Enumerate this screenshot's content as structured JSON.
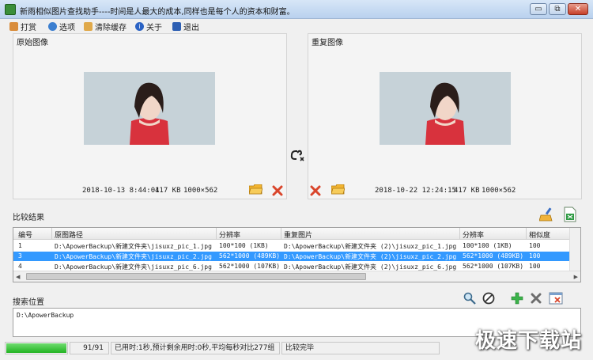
{
  "window": {
    "title": "新雨相似图片查找助手----时间是人最大的成本,同样也是每个人的资本和财富。",
    "minimize_glyph": "▭",
    "restore_glyph": "⧉",
    "close_glyph": "✕"
  },
  "menu": {
    "items": [
      {
        "label": "打赏",
        "icon": "gift-icon"
      },
      {
        "label": "选项",
        "icon": "options-icon"
      },
      {
        "label": "清除缓存",
        "icon": "broom-icon"
      },
      {
        "label": "关于",
        "icon": "info-icon"
      },
      {
        "label": "退出",
        "icon": "exit-icon"
      }
    ]
  },
  "panels": {
    "original": {
      "label": "原始图像",
      "date": "2018-10-13 8:44:01",
      "size": "417 KB",
      "dims": "1000×562"
    },
    "duplicate": {
      "label": "重复图像",
      "date": "2018-10-22 12:24:15",
      "size": "417 KB",
      "dims": "1000×562"
    }
  },
  "results": {
    "label": "比较结果",
    "headers": [
      "编号",
      "原图路径",
      "分辨率",
      "重复图片",
      "分辨率",
      "相似度"
    ],
    "rows": [
      {
        "no": "1",
        "orig": "D:\\ApowerBackup\\新建文件夹\\jisuxz_pic_1.jpg",
        "res1": "100*100 (1KB)",
        "dup": "D:\\ApowerBackup\\新建文件夹 (2)\\jisuxz_pic_1.jpg",
        "res2": "100*100 (1KB)",
        "sim": "100"
      },
      {
        "no": "3",
        "orig": "D:\\ApowerBackup\\新建文件夹\\jisuxz_pic_2.jpg",
        "res1": "562*1000 (489KB)",
        "dup": "D:\\ApowerBackup\\新建文件夹 (2)\\jisuxz_pic_2.jpg",
        "res2": "562*1000 (489KB)",
        "sim": "100"
      },
      {
        "no": "4",
        "orig": "D:\\ApowerBackup\\新建文件夹\\jisuxz_pic_6.jpg",
        "res1": "562*1000 (107KB)",
        "dup": "D:\\ApowerBackup\\新建文件夹 (2)\\jisuxz_pic_6.jpg",
        "res2": "562*1000 (107KB)",
        "sim": "100"
      }
    ]
  },
  "search": {
    "label": "搜索位置",
    "path": "D:\\ApowerBackup"
  },
  "status": {
    "progress_fraction": 1.0,
    "count": "91/91",
    "time_text": "已用时:1秒,预计剩余用时:0秒,平均每秒对比277组",
    "result_text": "比较完毕"
  },
  "watermark": "极速下载站",
  "colors": {
    "selection": "#3399ff",
    "progress": "#22b322",
    "folder": "#f2b430",
    "delete": "#d9452b"
  }
}
